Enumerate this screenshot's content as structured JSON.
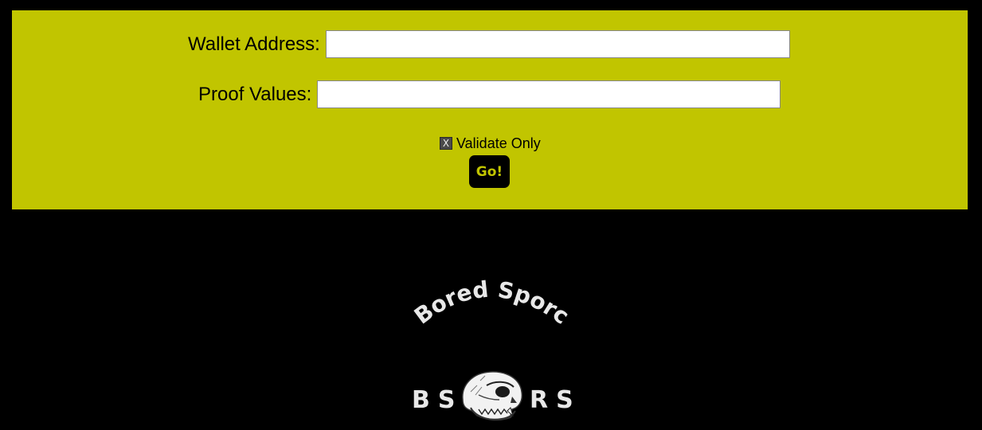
{
  "form": {
    "wallet_label": "Wallet Address:",
    "wallet_value": "",
    "proof_label": "Proof Values:",
    "proof_value": "",
    "validate_checkbox_mark": "X",
    "validate_label": "Validate Only",
    "go_label": "Go!"
  },
  "logo": {
    "arc_text": "Bored Sporc",
    "initials_left": "BS",
    "initials_right": "RS",
    "skull_icon": "skull-icon"
  },
  "colors": {
    "panel_bg": "#c1c500",
    "page_bg": "#000000",
    "logo_text": "#e8e8e8"
  }
}
